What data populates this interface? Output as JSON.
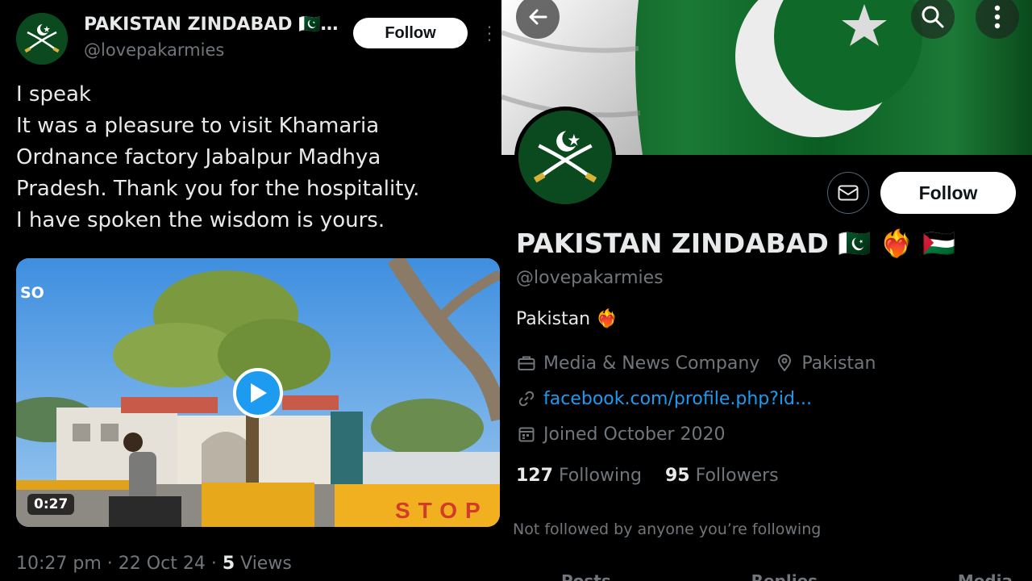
{
  "post": {
    "author_name": "PAKISTAN ZINDABAD 🇵🇰…",
    "author_handle": "@lovepakarmies",
    "follow_label": "Follow",
    "text_lines": [
      "I speak",
      "It was a pleasure to visit Khamaria",
      "Ordnance factory Jabalpur Madhya",
      "Pradesh. Thank you for the hospitality.",
      "I have spoken the wisdom is yours."
    ],
    "video": {
      "overlay_text": "SO",
      "duration": "0:27",
      "sign_text": "STOP"
    },
    "time": "10:27 pm",
    "date": "22 Oct 24",
    "views_count": "5",
    "views_label": "Views",
    "separator": "·"
  },
  "profile": {
    "name": "PAKISTAN ZINDABAD 🇵🇰 ❤️‍🔥 🇵🇸",
    "handle": "@lovepakarmies",
    "follow_label": "Follow",
    "bio": "Pakistan ❤️‍🔥",
    "category": "Media & News Company",
    "location": "Pakistan",
    "website": "facebook.com/profile.php?id...",
    "joined": "Joined October 2020",
    "following_count": "127",
    "following_label": "Following",
    "followers_count": "95",
    "followers_label": "Followers",
    "not_followed_text": "Not followed by anyone you’re following",
    "tabs": [
      "Posts",
      "Replies",
      "Media"
    ]
  },
  "icons": {
    "back": "arrow-left-icon",
    "search": "search-icon",
    "more": "more-vertical-icon",
    "message": "envelope-icon",
    "category": "briefcase-icon",
    "location": "location-pin-icon",
    "link": "link-icon",
    "calendar": "calendar-icon",
    "play": "play-icon"
  },
  "colors": {
    "background": "#000000",
    "text": "#e7e9ea",
    "muted": "#71767b",
    "accent": "#1d9bf0",
    "flag_green": "#0b5d23",
    "avatar_green": "#0a4a1e"
  }
}
